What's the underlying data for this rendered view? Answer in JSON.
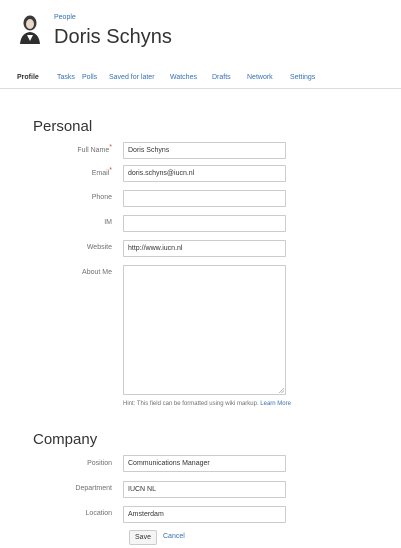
{
  "header": {
    "breadcrumb": "People",
    "title": "Doris Schyns"
  },
  "tabs": [
    {
      "label": "Profile",
      "active": true
    },
    {
      "label": "Tasks"
    },
    {
      "label": "Polls"
    },
    {
      "label": "Saved for later"
    },
    {
      "label": "Watches"
    },
    {
      "label": "Drafts"
    },
    {
      "label": "Network"
    },
    {
      "label": "Settings"
    }
  ],
  "personal": {
    "title": "Personal",
    "full_name": {
      "label": "Full Name",
      "value": "Doris Schyns",
      "required": true
    },
    "email": {
      "label": "Email",
      "value": "doris.schyns@iucn.nl",
      "required": true
    },
    "phone": {
      "label": "Phone",
      "value": ""
    },
    "im": {
      "label": "IM",
      "value": ""
    },
    "website": {
      "label": "Website",
      "value": "http://www.iucn.nl"
    },
    "about": {
      "label": "About Me",
      "value": ""
    },
    "hint": "Hint: This field can be formatted using wiki markup.",
    "learn_more": "Learn More"
  },
  "company": {
    "title": "Company",
    "position": {
      "label": "Position",
      "value": "Communications Manager"
    },
    "department": {
      "label": "Department",
      "value": "IUCN NL"
    },
    "location": {
      "label": "Location",
      "value": "Amsterdam"
    }
  },
  "actions": {
    "save": "Save",
    "cancel": "Cancel"
  },
  "colors": {
    "link": "#3572b0",
    "required": "#d04437"
  },
  "icons": {
    "avatar": "person-avatar-icon",
    "resize": "resize-grip-icon"
  }
}
